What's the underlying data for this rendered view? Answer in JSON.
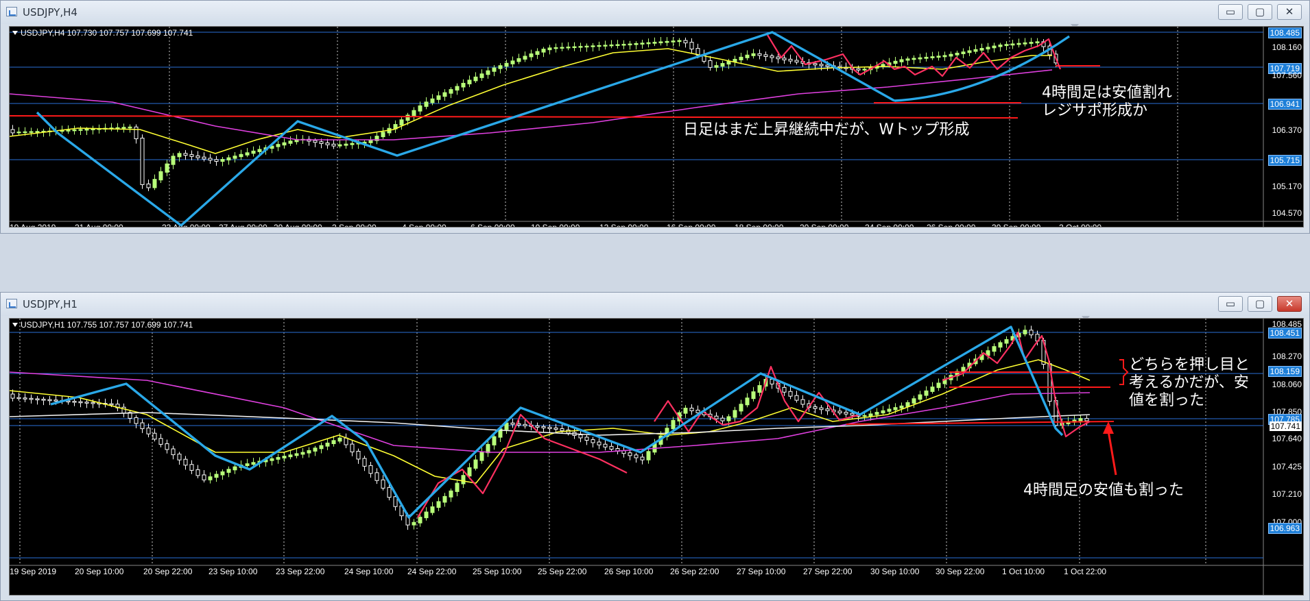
{
  "windows": [
    {
      "title": "USDJPY,H4",
      "header": "USDJPY,H4  107.730 107.757 107.699 107.741",
      "buttons": {
        "minimize": "▭",
        "maximize": "▢",
        "close": "✕"
      },
      "price_labels": [
        "108.485",
        "108.160",
        "107.719",
        "107.560",
        "106.941",
        "106.370",
        "105.715",
        "105.170",
        "104.570"
      ],
      "time_labels": [
        "19 Aug 2019",
        "21 Aug 00:00",
        "23 Aug 00:00",
        "27 Aug 00:00",
        "29 Aug 00:00",
        "2 Sep 00:00",
        "4 Sep 00:00",
        "6 Sep 00:00",
        "10 Sep 00:00",
        "12 Sep 00:00",
        "16 Sep 00:00",
        "18 Sep 00:00",
        "20 Sep 00:00",
        "24 Sep 00:00",
        "26 Sep 00:00",
        "30 Sep 00:00",
        "2 Oct 00:00"
      ],
      "notes": [
        "4時間足は安値割れ\nレジサポ形成か",
        "日足はまだ上昇継続中だが、Wトップ形成"
      ]
    },
    {
      "title": "USDJPY,H1",
      "header": "USDJPY,H1  107.755 107.757 107.699 107.741",
      "buttons": {
        "minimize": "▭",
        "maximize": "▢",
        "close": "✕"
      },
      "price_labels": [
        "108.485",
        "108.451",
        "108.270",
        "108.159",
        "108.060",
        "107.850",
        "107.785",
        "107.741",
        "107.640",
        "107.425",
        "107.210",
        "107.000",
        "106.963"
      ],
      "time_labels": [
        "19 Sep 2019",
        "20 Sep 10:00",
        "20 Sep 22:00",
        "23 Sep 10:00",
        "23 Sep 22:00",
        "24 Sep 10:00",
        "24 Sep 22:00",
        "25 Sep 10:00",
        "25 Sep 22:00",
        "26 Sep 10:00",
        "26 Sep 22:00",
        "27 Sep 10:00",
        "27 Sep 22:00",
        "30 Sep 10:00",
        "30 Sep 22:00",
        "1 Oct 10:00",
        "1 Oct 22:00"
      ],
      "notes": [
        "どちらを押し目と\n考えるかだが、安\n値を割った",
        "4時間足の安値も割った"
      ]
    }
  ],
  "colors": {
    "chart_bg": "#000000",
    "grid": "#c8c8c8",
    "ma_yellow": "#ffff33",
    "ma_magenta": "#e040e0",
    "ma_white": "#f0f0f0",
    "trend_blue": "#2aa8e8",
    "zigzag": "#ff3060",
    "sr_red": "#ff1a1a",
    "hline_blue": "#2a6fd8",
    "bull": "#b8ff7a",
    "bear": "#ffffff"
  }
}
